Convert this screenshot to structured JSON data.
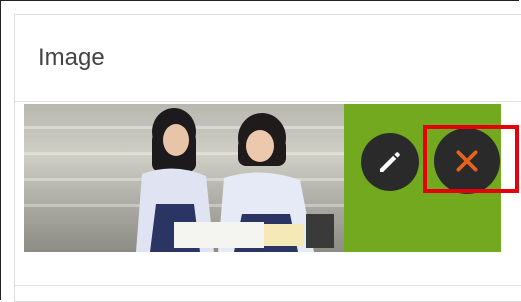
{
  "panel": {
    "title": "Image"
  },
  "image_actions": {
    "edit_icon": "pencil-icon",
    "delete_icon": "close-icon",
    "delete_color": "#e8621f"
  },
  "highlight": {
    "color": "#e5000a"
  }
}
